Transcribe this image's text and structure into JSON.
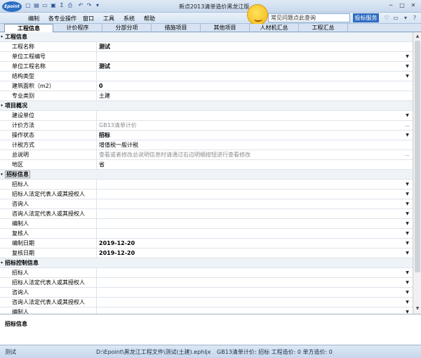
{
  "app": {
    "logo": "Epoint",
    "title": "新点2013清单造价黑龙江版"
  },
  "menu": [
    "编制",
    "各专业操作",
    "窗口",
    "工具",
    "系统",
    "帮助"
  ],
  "search": {
    "value": "常见问题点此查询"
  },
  "bid_service_label": "投标服务",
  "tabs": [
    {
      "label": "工程信息",
      "active": true
    },
    {
      "label": "计价程序"
    },
    {
      "label": "分部分项"
    },
    {
      "label": "措施项目"
    },
    {
      "label": "其他项目"
    },
    {
      "label": "人材机汇总"
    },
    {
      "label": "工程汇总"
    }
  ],
  "rows": [
    {
      "label": "工程信息",
      "section": true
    },
    {
      "label": "工程名称",
      "value": "测试",
      "bold": true
    },
    {
      "label": "单位工程编号",
      "value": "",
      "control": "dropdown"
    },
    {
      "label": "单位工程名称",
      "value": "测试",
      "bold": true,
      "control": "dropdown"
    },
    {
      "label": "结构类型",
      "value": "",
      "control": "dropdown"
    },
    {
      "label": "建筑面积（m2）",
      "value": "0",
      "bold": true
    },
    {
      "label": "专业类别",
      "value": "土建"
    },
    {
      "label": "项目概况",
      "section": true
    },
    {
      "label": "建设单位",
      "value": "",
      "control": "dropdown"
    },
    {
      "label": "计价方法",
      "value": "GB13清单计价",
      "grey": true,
      "control": "dash"
    },
    {
      "label": "操作状态",
      "value": "招标",
      "bold": true,
      "control": "dropdown"
    },
    {
      "label": "计税方式",
      "value": "增值税一般计税"
    },
    {
      "label": "总说明",
      "value": "查看或者修改总说明信息时请通过右边明细按钮进行查看修改",
      "grey": true,
      "control": "dash"
    },
    {
      "label": "地区",
      "value": "省"
    },
    {
      "label": "招标信息",
      "section": true,
      "boxed": true
    },
    {
      "label": "招标人",
      "value": "",
      "control": "dropdown"
    },
    {
      "label": "招标人法定代表人或其授权人",
      "value": "",
      "control": "dropdown"
    },
    {
      "label": "咨询人",
      "value": "",
      "control": "dropdown"
    },
    {
      "label": "咨询人法定代表人或其授权人",
      "value": "",
      "control": "dropdown"
    },
    {
      "label": "编制人",
      "value": "",
      "control": "dropdown"
    },
    {
      "label": "复核人",
      "value": "",
      "control": "dropdown"
    },
    {
      "label": "编制日期",
      "value": "2019-12-20",
      "bold": true,
      "control": "dropdown"
    },
    {
      "label": "复核日期",
      "value": "2019-12-20",
      "bold": true,
      "control": "dropdown"
    },
    {
      "label": "招标控制信息",
      "section": true
    },
    {
      "label": "招标人",
      "value": "",
      "control": "dropdown"
    },
    {
      "label": "招标人法定代表人或其授权人",
      "value": "",
      "control": "dropdown"
    },
    {
      "label": "咨询人",
      "value": "",
      "control": "dropdown"
    },
    {
      "label": "咨询人法定代表人或其授权人",
      "value": "",
      "control": "dropdown"
    },
    {
      "label": "编制人",
      "value": "",
      "control": "dropdown"
    }
  ],
  "info_panel": {
    "title": "招标信息"
  },
  "status": {
    "project": "测试",
    "path": "D:\\Epoint\\黑龙江工程文件\\测试(土建).ephljx",
    "summary": "GB13清单计价: 招标  工程造价: 0  单方造价: 0"
  }
}
